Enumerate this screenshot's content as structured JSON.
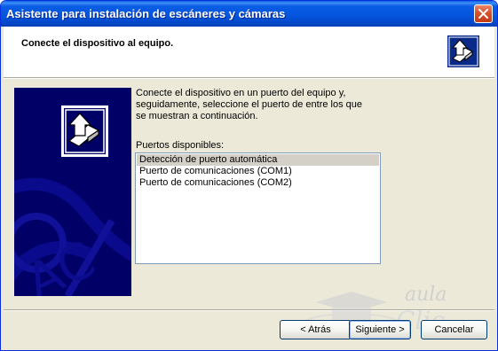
{
  "window": {
    "title": "Asistente para instalación de escáneres y cámaras"
  },
  "header": {
    "title": "Conecte el dispositivo al equipo."
  },
  "main": {
    "description": "Conecte el dispositivo en un puerto del equipo y, seguidamente, seleccione el puerto de entre los que se muestran a continuación.",
    "ports_label": "Puertos disponibles:",
    "ports": [
      "Detección de puerto automática",
      "Puerto de comunicaciones (COM1)",
      "Puerto de comunicaciones (COM2)"
    ],
    "selected_port": "Detección de puerto automática"
  },
  "buttons": {
    "back": "< Atrás",
    "next": "Siguiente >",
    "cancel": "Cancelar"
  },
  "watermark": {
    "text": "aula Clic"
  },
  "icons": {
    "close": "close-icon",
    "wizard": "scanner-camera-wizard-icon"
  },
  "colors": {
    "titlebar": "#0453dd",
    "side_panel": "#000066",
    "dialog_bg": "#ece9d8",
    "close_button": "#d9502c"
  }
}
